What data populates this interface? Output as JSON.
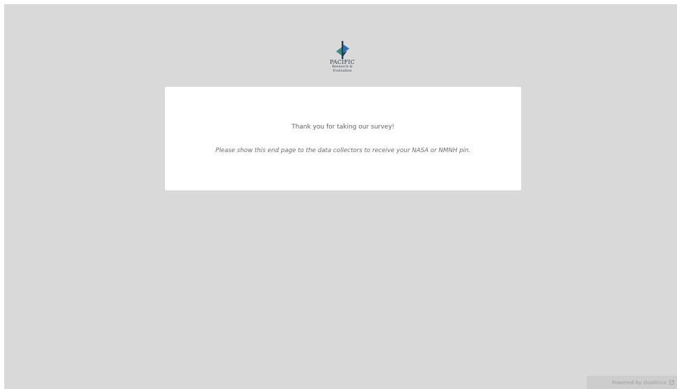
{
  "logo": {
    "icon": "pacific-research-logo-icon",
    "name": "PACIFIC",
    "line2": "Research &",
    "line3": "Evaluation"
  },
  "card": {
    "thanks": "Thank you for taking our survey!",
    "instructions": "Please show this end page to the data collectors to receive your NASA or NMNH pin."
  },
  "footer": {
    "powered_by": "Powered by Qualtrics",
    "icon": "external-link-icon"
  },
  "colors": {
    "page_background": "#d9d9d9",
    "card_background": "#ffffff",
    "logo_blue": "#2f6fb0",
    "logo_navy": "#1d3b5c",
    "logo_teal": "#3d8c7f"
  }
}
